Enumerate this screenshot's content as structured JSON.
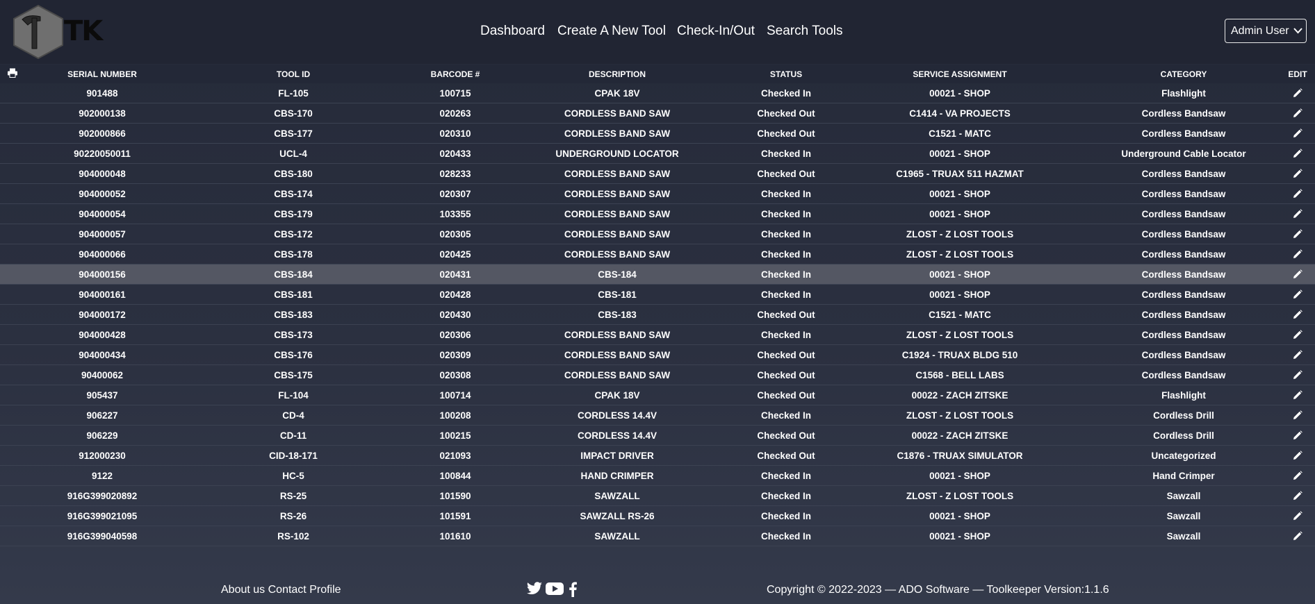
{
  "app": {
    "logo_text": "TK",
    "nav": [
      "Dashboard",
      "Create A New Tool",
      "Check-In/Out",
      "Search Tools"
    ],
    "user": "Admin User"
  },
  "table": {
    "headers": [
      "SERIAL NUMBER",
      "TOOL ID",
      "BARCODE #",
      "DESCRIPTION",
      "STATUS",
      "SERVICE ASSIGNMENT",
      "CATEGORY",
      "EDIT"
    ],
    "rows": [
      [
        "901488",
        "FL-105",
        "100715",
        "CPAK 18V",
        "Checked In",
        "00021 - SHOP",
        "Flashlight"
      ],
      [
        "902000138",
        "CBS-170",
        "020263",
        "CORDLESS BAND SAW",
        "Checked Out",
        "C1414 - VA PROJECTS",
        "Cordless Bandsaw"
      ],
      [
        "902000866",
        "CBS-177",
        "020310",
        "CORDLESS BAND SAW",
        "Checked Out",
        "C1521 - MATC",
        "Cordless Bandsaw"
      ],
      [
        "90220050011",
        "UCL-4",
        "020433",
        "UNDERGROUND LOCATOR",
        "Checked In",
        "00021 - SHOP",
        "Underground Cable Locator"
      ],
      [
        "904000048",
        "CBS-180",
        "028233",
        "CORDLESS BAND SAW",
        "Checked Out",
        "C1965 - TRUAX 511 HAZMAT",
        "Cordless Bandsaw"
      ],
      [
        "904000052",
        "CBS-174",
        "020307",
        "CORDLESS BAND SAW",
        "Checked In",
        "00021 - SHOP",
        "Cordless Bandsaw"
      ],
      [
        "904000054",
        "CBS-179",
        "103355",
        "CORDLESS BAND SAW",
        "Checked In",
        "00021 - SHOP",
        "Cordless Bandsaw"
      ],
      [
        "904000057",
        "CBS-172",
        "020305",
        "CORDLESS BAND SAW",
        "Checked In",
        "ZLOST - Z LOST TOOLS",
        "Cordless Bandsaw"
      ],
      [
        "904000066",
        "CBS-178",
        "020425",
        "CORDLESS BAND SAW",
        "Checked In",
        "ZLOST - Z LOST TOOLS",
        "Cordless Bandsaw"
      ],
      [
        "904000156",
        "CBS-184",
        "020431",
        "CBS-184",
        "Checked In",
        "00021 - SHOP",
        "Cordless Bandsaw"
      ],
      [
        "904000161",
        "CBS-181",
        "020428",
        "CBS-181",
        "Checked In",
        "00021 - SHOP",
        "Cordless Bandsaw"
      ],
      [
        "904000172",
        "CBS-183",
        "020430",
        "CBS-183",
        "Checked Out",
        "C1521 - MATC",
        "Cordless Bandsaw"
      ],
      [
        "904000428",
        "CBS-173",
        "020306",
        "CORDLESS BAND SAW",
        "Checked In",
        "ZLOST - Z LOST TOOLS",
        "Cordless Bandsaw"
      ],
      [
        "904000434",
        "CBS-176",
        "020309",
        "CORDLESS BAND SAW",
        "Checked Out",
        "C1924 - TRUAX BLDG 510",
        "Cordless Bandsaw"
      ],
      [
        "90400062",
        "CBS-175",
        "020308",
        "CORDLESS BAND SAW",
        "Checked Out",
        "C1568 - BELL LABS",
        "Cordless Bandsaw"
      ],
      [
        "905437",
        "FL-104",
        "100714",
        "CPAK 18V",
        "Checked Out",
        "00022 - ZACH ZITSKE",
        "Flashlight"
      ],
      [
        "906227",
        "CD-4",
        "100208",
        "CORDLESS 14.4V",
        "Checked In",
        "ZLOST - Z LOST TOOLS",
        "Cordless Drill"
      ],
      [
        "906229",
        "CD-11",
        "100215",
        "CORDLESS 14.4V",
        "Checked Out",
        "00022 - ZACH ZITSKE",
        "Cordless Drill"
      ],
      [
        "912000230",
        "CID-18-171",
        "021093",
        "IMPACT DRIVER",
        "Checked Out",
        "C1876 - TRUAX SIMULATOR",
        "Uncategorized"
      ],
      [
        "9122",
        "HC-5",
        "100844",
        "HAND CRIMPER",
        "Checked In",
        "00021 - SHOP",
        "Hand Crimper"
      ],
      [
        "916G399020892",
        "RS-25",
        "101590",
        "SAWZALL",
        "Checked In",
        "ZLOST - Z LOST TOOLS",
        "Sawzall"
      ],
      [
        "916G399021095",
        "RS-26",
        "101591",
        "SAWZALL RS-26",
        "Checked In",
        "00021 - SHOP",
        "Sawzall"
      ],
      [
        "916G399040598",
        "RS-102",
        "101610",
        "SAWZALL",
        "Checked In",
        "00021 - SHOP",
        "Sawzall"
      ]
    ],
    "highlighted_row": 9
  },
  "footer": {
    "links": [
      "About us",
      "Contact",
      "Profile"
    ],
    "copyright": "Copyright © 2022-2023 — ADO Software — Toolkeeper Version:1.1.6"
  },
  "icons": {
    "print": "printer-icon",
    "edit": "pencil-icon",
    "social": [
      "twitter-icon",
      "youtube-icon",
      "facebook-icon"
    ]
  }
}
